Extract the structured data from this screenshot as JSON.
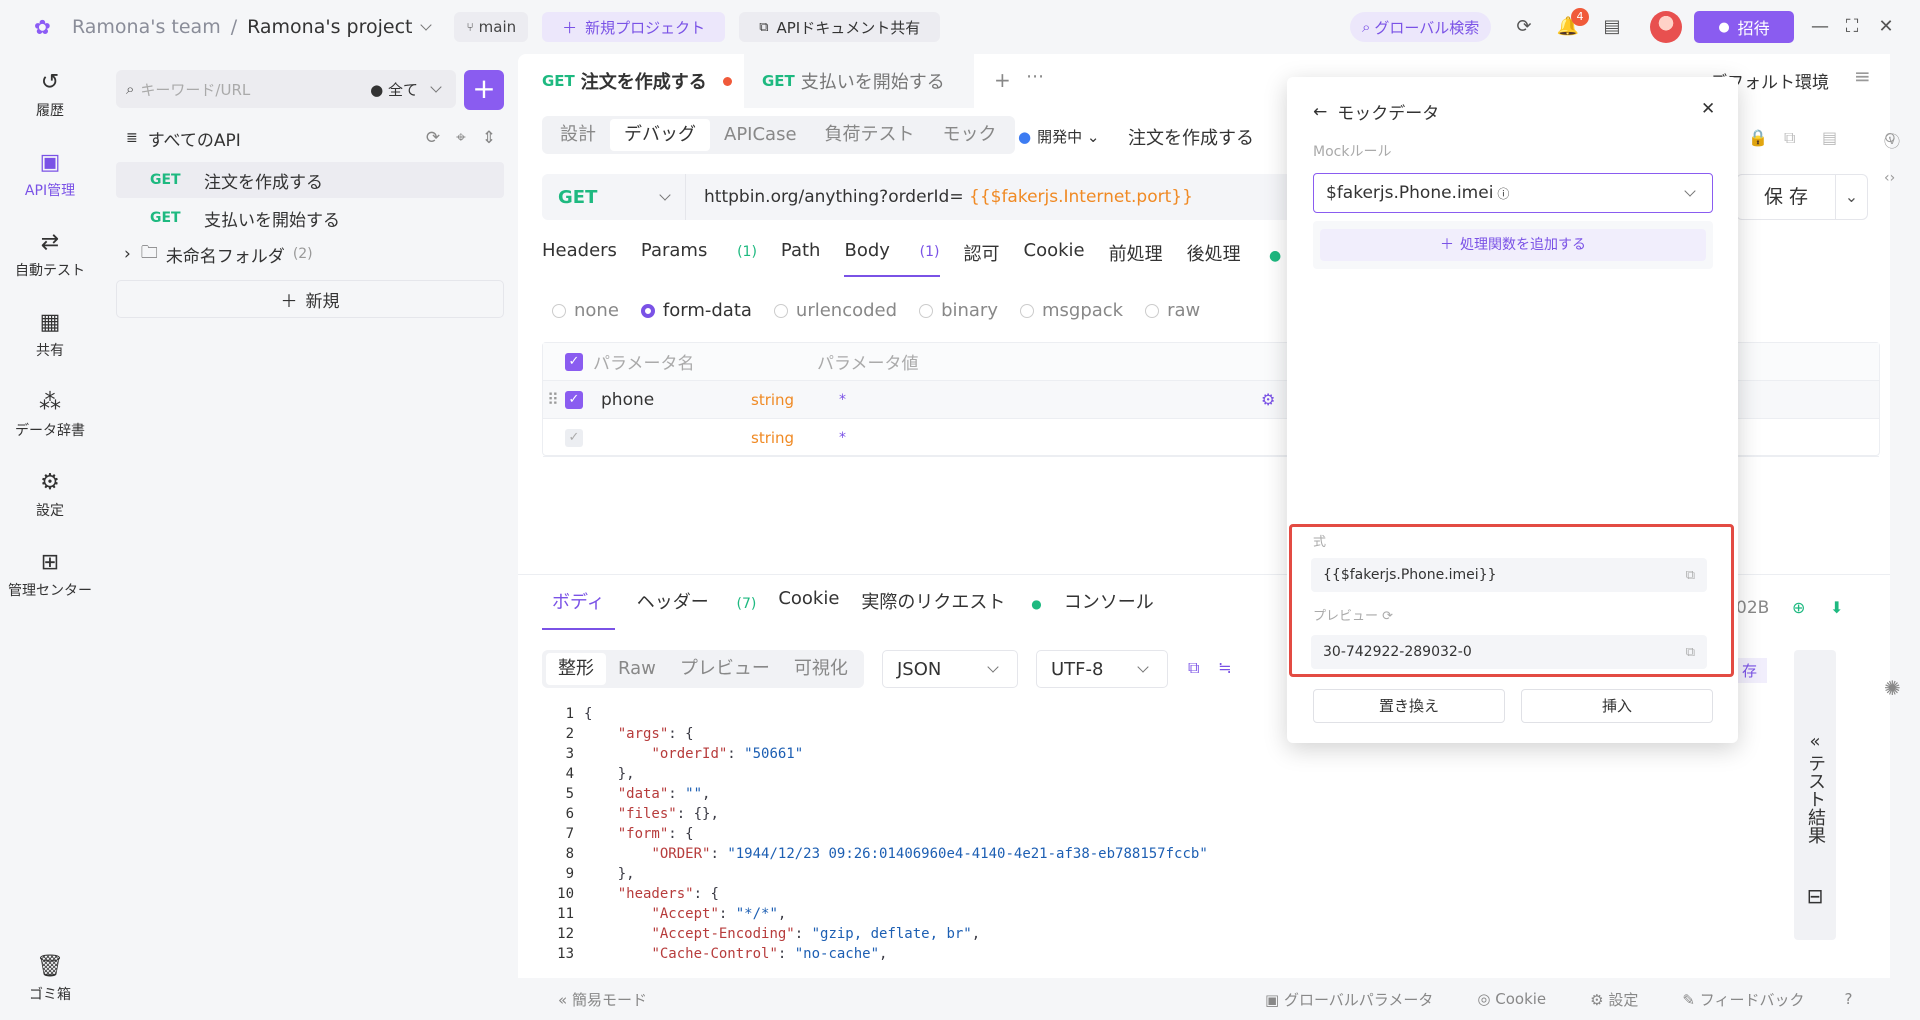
{
  "topbar": {
    "team": "Ramona's team",
    "sep": "/",
    "project": "Ramona's project",
    "branch": "main",
    "new_project": "新規プロジェクト",
    "api_share": "APIドキュメント共有",
    "global_search": "グローバル検索",
    "notif_count": "4",
    "invite": "招待"
  },
  "rail": {
    "history": "履歴",
    "api": "API管理",
    "autotest": "自動テスト",
    "share": "共有",
    "dict": "データ辞書",
    "settings": "設定",
    "admin": "管理センター",
    "trash": "ゴミ箱"
  },
  "apipanel": {
    "search_placeholder": "キーワード/URL",
    "filter": "全て",
    "all_api": "すべてのAPI",
    "items": [
      {
        "method": "GET",
        "name": "注文を作成する"
      },
      {
        "method": "GET",
        "name": "支払いを開始する"
      }
    ],
    "folder": "未命名フォルダ",
    "folder_count": "(2)",
    "new": "新規"
  },
  "tabs": [
    {
      "method": "GET",
      "name": "注文を作成する"
    },
    {
      "method": "GET",
      "name": "支払いを開始する"
    }
  ],
  "env": "デフォルト環境",
  "subnav": [
    "設計",
    "デバッグ",
    "APICase",
    "負荷テスト",
    "モック"
  ],
  "status": "開発中",
  "api_title": "注文を作成する",
  "request": {
    "method": "GET",
    "url_plain": "httpbin.org/anything?orderId=",
    "url_var": "{{$fakerjs.Internet.port}}",
    "save": "保 存"
  },
  "reqtabs": {
    "headers": "Headers",
    "params": "Params",
    "params_n": "(1)",
    "path": "Path",
    "body": "Body",
    "body_n": "(1)",
    "auth": "認可",
    "cookie": "Cookie",
    "pre": "前処理",
    "post": "後処理"
  },
  "body_types": [
    "none",
    "form-data",
    "urlencoded",
    "binary",
    "msgpack",
    "raw"
  ],
  "params_table": {
    "col_name": "パラメータ名",
    "col_value": "パラメータ値",
    "rows": [
      {
        "name": "phone",
        "type": "string",
        "req": "*"
      },
      {
        "name": "",
        "type": "string",
        "req": "*"
      }
    ]
  },
  "response": {
    "tabs": {
      "body": "ボディ",
      "header": "ヘッダー",
      "header_n": "(7)",
      "cookie": "Cookie",
      "actual": "実際のリクエスト",
      "console": "コンソール"
    },
    "size": "02B",
    "formats": [
      "整形",
      "Raw",
      "プレビュー",
      "可視化"
    ],
    "lang": "JSON",
    "encoding": "UTF-8",
    "save_tail": "存",
    "side": "テスト結果"
  },
  "code_lines": [
    {
      "n": "1",
      "t": "{"
    },
    {
      "n": "2",
      "t": "    \"args\": {"
    },
    {
      "n": "3",
      "t": "        \"orderId\": \"50661\""
    },
    {
      "n": "4",
      "t": "    },"
    },
    {
      "n": "5",
      "t": "    \"data\": \"\","
    },
    {
      "n": "6",
      "t": "    \"files\": {},"
    },
    {
      "n": "7",
      "t": "    \"form\": {"
    },
    {
      "n": "8",
      "t": "        \"ORDER\": \"1944/12/23 09:26:01406960e4-4140-4e21-af38-eb788157fccb\""
    },
    {
      "n": "9",
      "t": "    },"
    },
    {
      "n": "10",
      "t": "    \"headers\": {"
    },
    {
      "n": "11",
      "t": "        \"Accept\": \"*/*\","
    },
    {
      "n": "12",
      "t": "        \"Accept-Encoding\": \"gzip, deflate, br\","
    },
    {
      "n": "13",
      "t": "        \"Cache-Control\": \"no-cache\","
    }
  ],
  "statusbar": {
    "simple": "簡易モード",
    "global": "グローバルパラメータ",
    "cookie": "Cookie",
    "settings": "設定",
    "feedback": "フィードバック"
  },
  "mock": {
    "title": "モックデータ",
    "rule_label": "Mockルール",
    "rule_value": "$fakerjs.Phone.imei",
    "add_fn": "処理関数を追加する",
    "expr_label": "式",
    "expr_value": "{{$fakerjs.Phone.imei}}",
    "preview_label": "プレビュー",
    "preview_value": "30-742922-289032-0",
    "replace": "置き換え",
    "insert": "挿入"
  },
  "colors": {
    "accent": "#8a5cf0",
    "get": "#1eb980",
    "var": "#f08a24",
    "highlight": "#e34b43"
  }
}
